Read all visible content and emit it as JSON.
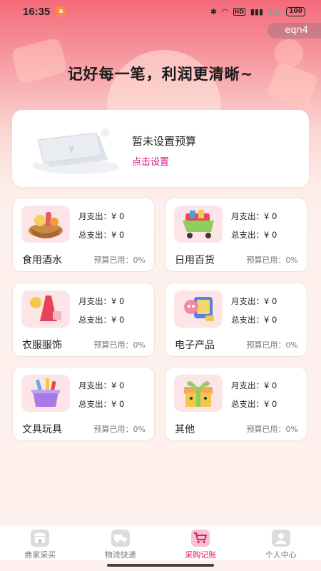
{
  "status": {
    "time": "16:35",
    "battery": "100"
  },
  "user_tag": "eqn4",
  "headline": "记好每一笔，利润更清晰~",
  "budget": {
    "title": "暂未设置预算",
    "action": "点击设置"
  },
  "categories": [
    {
      "name": "食用酒水",
      "monthly_label": "月支出：",
      "monthly_value": "¥ 0",
      "total_label": "总支出：",
      "total_value": "¥ 0",
      "used_label": "预算已用：",
      "used_value": "0%",
      "icon": "food-basket-icon"
    },
    {
      "name": "日用百货",
      "monthly_label": "月支出：",
      "monthly_value": "¥ 0",
      "total_label": "总支出：",
      "total_value": "¥ 0",
      "used_label": "预算已用：",
      "used_value": "0%",
      "icon": "shopping-cart-icon"
    },
    {
      "name": "衣服服饰",
      "monthly_label": "月支出：",
      "monthly_value": "¥ 0",
      "total_label": "总支出：",
      "total_value": "¥ 0",
      "used_label": "预算已用：",
      "used_value": "0%",
      "icon": "dress-icon"
    },
    {
      "name": "电子产品",
      "monthly_label": "月支出：",
      "monthly_value": "¥ 0",
      "total_label": "总支出：",
      "total_value": "¥ 0",
      "used_label": "预算已用：",
      "used_value": "0%",
      "icon": "electronics-icon"
    },
    {
      "name": "文具玩具",
      "monthly_label": "月支出：",
      "monthly_value": "¥ 0",
      "total_label": "总支出：",
      "total_value": "¥ 0",
      "used_label": "预算已用：",
      "used_value": "0%",
      "icon": "stationery-basket-icon"
    },
    {
      "name": "其他",
      "monthly_label": "月支出：",
      "monthly_value": "¥ 0",
      "total_label": "总支出：",
      "total_value": "¥ 0",
      "used_label": "预算已用：",
      "used_value": "0%",
      "icon": "gift-box-icon"
    }
  ],
  "tabs": [
    {
      "label": "商家采买",
      "icon": "store-icon",
      "active": false
    },
    {
      "label": "物流快递",
      "icon": "truck-icon",
      "active": false
    },
    {
      "label": "采购记账",
      "icon": "cart-icon",
      "active": true
    },
    {
      "label": "个人中心",
      "icon": "person-icon",
      "active": false
    }
  ],
  "colors": {
    "accent": "#e0186b",
    "budget_action": "#d11a8a",
    "icon_bg": "#fde4e6"
  }
}
